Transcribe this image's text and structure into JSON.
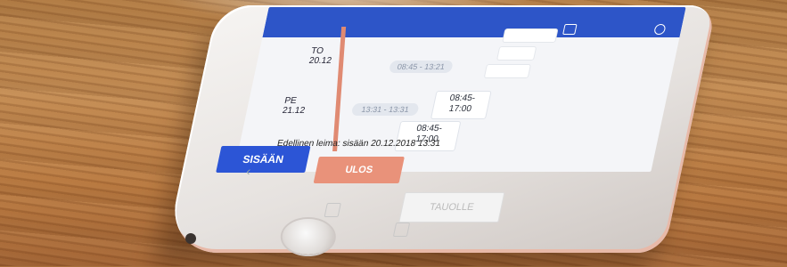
{
  "colors": {
    "primary": "#2c55d6",
    "accent_out": "#e9927a",
    "timeline": "#e08a72"
  },
  "days": [
    {
      "label": "TO",
      "date": "20.12"
    },
    {
      "label": "PE",
      "date": "21.12"
    }
  ],
  "pills": [
    "08:45 - 13:21",
    "13:31 - 13:31"
  ],
  "shifts": [
    "08:45-\n17:00",
    "08:45-\n17:00"
  ],
  "last_stamp": "Edellinen leima: sisään 20.12.2018 13:31",
  "buttons": {
    "in": "SISÄÄN",
    "out": "ULOS",
    "break": "TAUOLLE"
  },
  "icons": [
    "calendar-icon",
    "user-add-icon",
    "back-chevron-icon",
    "share-icon",
    "book-icon",
    "home-button-icon"
  ]
}
